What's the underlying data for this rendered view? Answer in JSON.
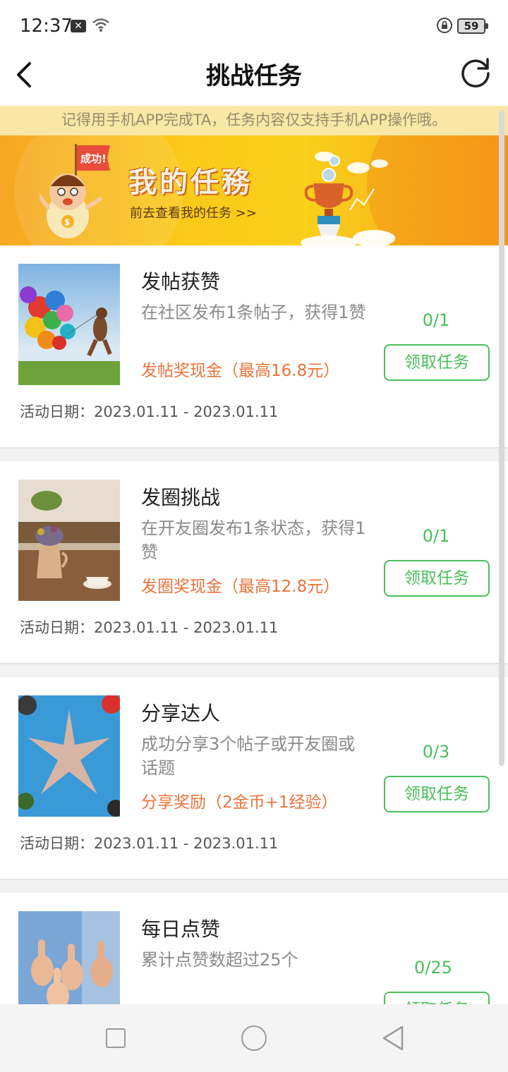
{
  "status_bar": {
    "time": "12:37",
    "notification_icon": "x-icon",
    "battery": "59"
  },
  "header": {
    "title": "挑战任务",
    "back_icon": "back-chevron-icon",
    "refresh_icon": "refresh-icon"
  },
  "notice": "记得用手机APP完成TA，任务内容仅支持手机APP操作哦。",
  "banner": {
    "title": "我的任務",
    "subtitle": "前去查看我的任务 >>",
    "flag_text": "成功!"
  },
  "tasks": [
    {
      "name": "发帖获赞",
      "desc": "在社区发布1条帖子，获得1赞",
      "reward": "发帖奖现金（最高16.8元）",
      "date": "活动日期：2023.01.11 - 2023.01.11",
      "progress": "0/1",
      "button": "领取任务",
      "image": "balloons-photo"
    },
    {
      "name": "发圈挑战",
      "desc": "在开友圈发布1条状态，获得1赞",
      "reward": "发圈奖现金（最高12.8元）",
      "date": "活动日期：2023.01.11 - 2023.01.11",
      "progress": "0/1",
      "button": "领取任务",
      "image": "flowers-coffee-photo"
    },
    {
      "name": "分享达人",
      "desc": "成功分享3个帖子或开友圈或话题",
      "reward": "分享奖励（2金币+1经验）",
      "date": "活动日期：2023.01.11 - 2023.01.11",
      "progress": "0/3",
      "button": "领取任务",
      "image": "hands-star-photo"
    },
    {
      "name": "每日点赞",
      "desc": "累计点赞数超过25个",
      "reward": "",
      "date": "",
      "progress": "0/25",
      "button": "领取任务",
      "image": "thumbs-up-photo"
    }
  ],
  "colors": {
    "accent_green": "#4bbf5a",
    "reward_orange": "#e8743b",
    "notice_bg": "#f9e7a5",
    "banner_yellow": "#fbc91a"
  }
}
